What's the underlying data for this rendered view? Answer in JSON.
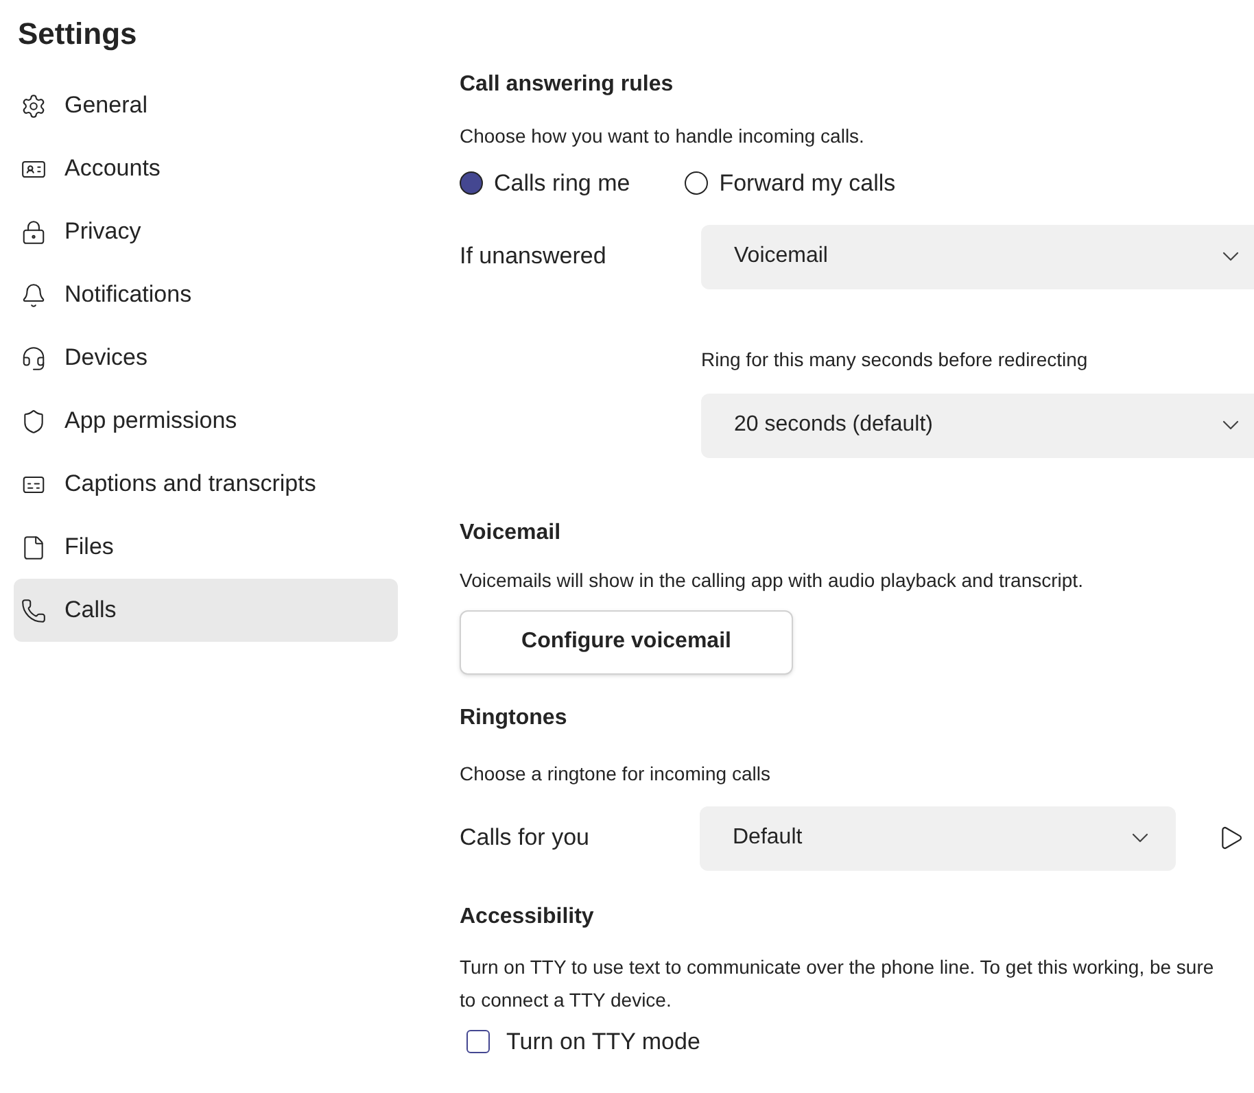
{
  "title": "Settings",
  "sidebar": {
    "items": [
      {
        "label": "General",
        "selected": false
      },
      {
        "label": "Accounts",
        "selected": false
      },
      {
        "label": "Privacy",
        "selected": false
      },
      {
        "label": "Notifications",
        "selected": false
      },
      {
        "label": "Devices",
        "selected": false
      },
      {
        "label": "App permissions",
        "selected": false
      },
      {
        "label": "Captions and transcripts",
        "selected": false
      },
      {
        "label": "Files",
        "selected": false
      },
      {
        "label": "Calls",
        "selected": true
      }
    ]
  },
  "call_answering_rules": {
    "heading": "Call answering rules",
    "description": "Choose how you want to handle incoming calls.",
    "options": [
      {
        "label": "Calls ring me",
        "selected": true
      },
      {
        "label": "Forward my calls",
        "selected": false
      }
    ],
    "if_unanswered": {
      "label": "If unanswered",
      "value": "Voicemail"
    },
    "ring_duration": {
      "label": "Ring for this many seconds before redirecting",
      "value": "20 seconds (default)"
    }
  },
  "voicemail": {
    "heading": "Voicemail",
    "description": "Voicemails will show in the calling app with audio playback and transcript.",
    "button": "Configure voicemail"
  },
  "ringtones": {
    "heading": "Ringtones",
    "description": "Choose a ringtone for incoming calls",
    "calls_for_you": {
      "label": "Calls for you",
      "value": "Default"
    }
  },
  "accessibility": {
    "heading": "Accessibility",
    "description": "Turn on TTY to use text to communicate over the phone line. To get this working, be sure to connect a TTY device.",
    "tty": {
      "label": "Turn on TTY mode",
      "checked": false
    }
  }
}
